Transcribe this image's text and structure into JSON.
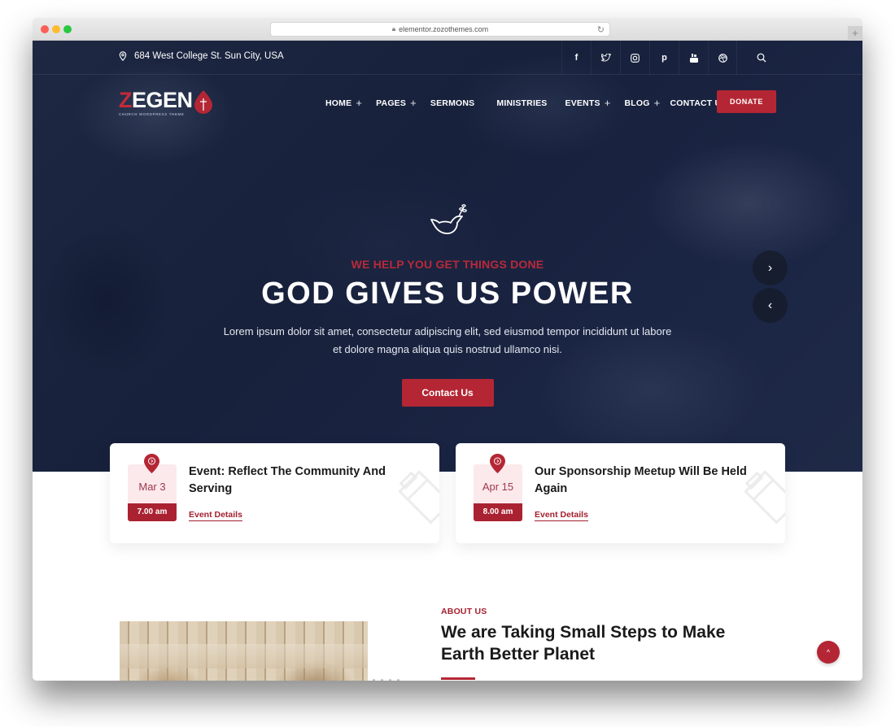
{
  "browser": {
    "url": "elementor.zozothemes.com"
  },
  "topbar": {
    "address": "684 West College St. Sun City, USA",
    "social_icons": [
      "facebook-icon",
      "twitter-icon",
      "instagram-icon",
      "pinterest-icon",
      "youtube-icon",
      "dribbble-icon"
    ],
    "social_glyphs": [
      "f",
      "🐦",
      "◎",
      "p",
      "▣",
      "⊕"
    ]
  },
  "logo": {
    "first_letter": "Z",
    "rest": "EGEN",
    "tagline": "CHURCH WORDPRESS THEME"
  },
  "nav": {
    "items": [
      {
        "label": "HOME",
        "has_submenu": true
      },
      {
        "label": "PAGES",
        "has_submenu": true
      },
      {
        "label": "SERMONS",
        "has_submenu": false
      },
      {
        "label": "MINISTRIES",
        "has_submenu": false
      },
      {
        "label": "EVENTS",
        "has_submenu": true
      },
      {
        "label": "BLOG",
        "has_submenu": true
      },
      {
        "label": "CONTACT US",
        "has_submenu": false
      }
    ],
    "plus": "+",
    "donate_label": "DONATE"
  },
  "hero": {
    "kicker": "WE HELP YOU GET THINGS DONE",
    "headline": "GOD GIVES US POWER",
    "lede": "Lorem ipsum dolor sit amet, consectetur adipiscing elit, sed eiusmod tempor incididunt ut labore et dolore magna aliqua quis nostrud ullamco nisi.",
    "cta_label": "Contact Us",
    "next_arrow": "›",
    "prev_arrow": "‹"
  },
  "events": [
    {
      "day": "Mar 3",
      "time": "7.00 am",
      "title": "Event: Reflect The Community And Serving",
      "link": "Event Details"
    },
    {
      "day": "Apr 15",
      "time": "8.00 am",
      "title": "Our Sponsorship Meetup Will Be Held Again",
      "link": "Event Details"
    }
  ],
  "about": {
    "kicker": "ABOUT US",
    "title": "We are Taking Small Steps to Make Earth Better Planet"
  },
  "scroll_top": "^",
  "colors": {
    "accent": "#b42634",
    "hero_overlay": "#1e2842"
  }
}
